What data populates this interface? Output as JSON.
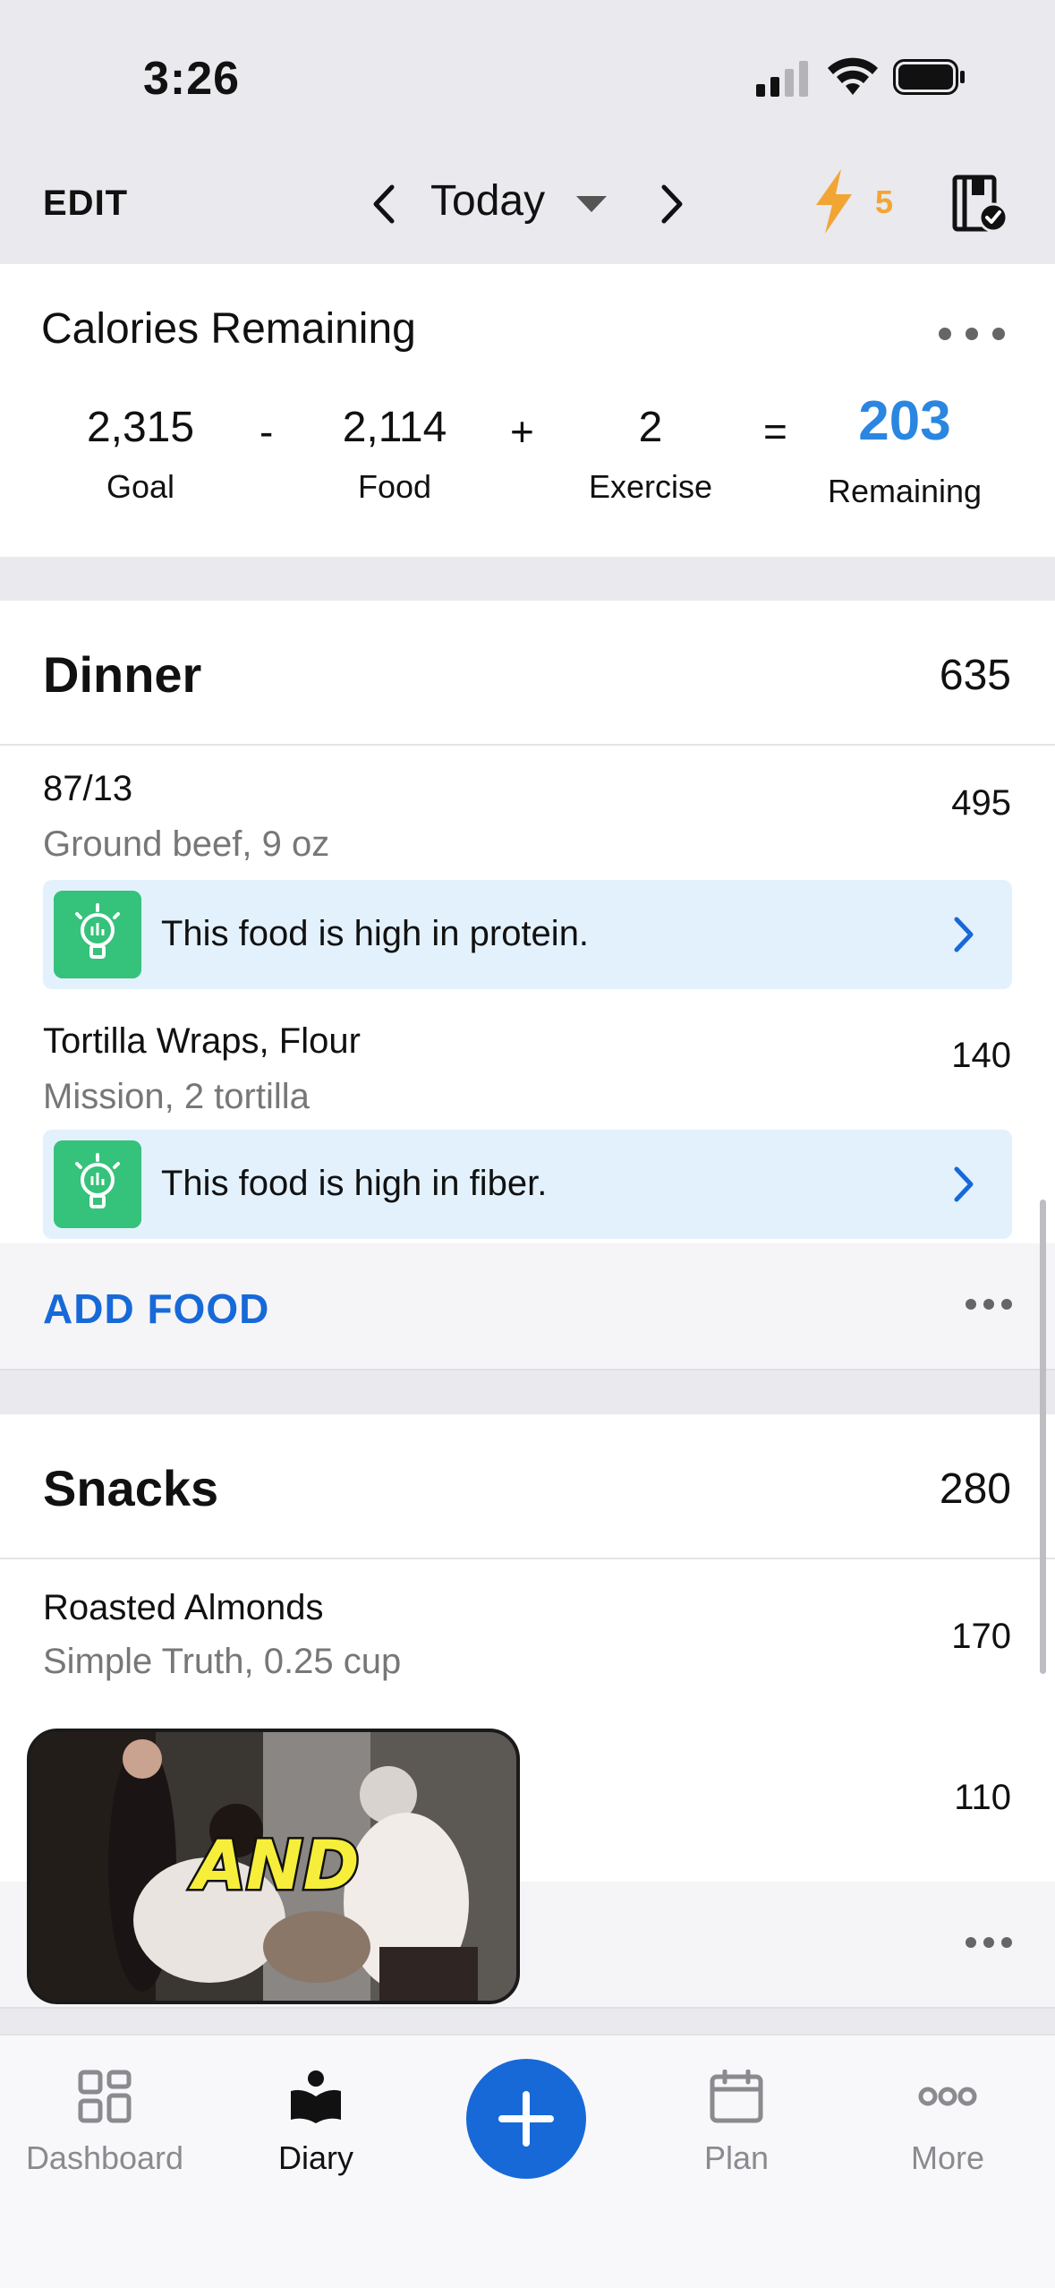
{
  "status_bar": {
    "time": "3:26"
  },
  "nav": {
    "edit": "EDIT",
    "date": "Today",
    "streak_count": "5"
  },
  "calories": {
    "title": "Calories Remaining",
    "goal": "2,315",
    "goal_label": "Goal",
    "minus": "-",
    "food": "2,114",
    "food_label": "Food",
    "plus": "+",
    "exercise": "2",
    "exercise_label": "Exercise",
    "equals": "=",
    "remaining": "203",
    "remaining_label": "Remaining"
  },
  "dinner": {
    "name": "Dinner",
    "total": "635",
    "items": [
      {
        "name": "87/13",
        "desc": "Ground beef, 9 oz",
        "cal": "495",
        "tip": "This food is high in protein."
      },
      {
        "name": "Tortilla Wraps, Flour",
        "desc": "Mission, 2 tortilla",
        "cal": "140",
        "tip": "This food is high in fiber."
      }
    ],
    "add_label": "ADD FOOD"
  },
  "snacks": {
    "name": "Snacks",
    "total": "280",
    "items": [
      {
        "name": "Roasted Almonds",
        "desc": "Simple Truth, 0.25 cup",
        "cal": "170"
      },
      {
        "name": "",
        "desc": "",
        "cal": "110"
      }
    ]
  },
  "video_overlay": {
    "caption": "AND"
  },
  "tabs": [
    {
      "label": "Dashboard",
      "icon": "dashboard-icon"
    },
    {
      "label": "Diary",
      "icon": "diary-icon"
    },
    {
      "label": "",
      "icon": "plus-icon"
    },
    {
      "label": "Plan",
      "icon": "calendar-icon"
    },
    {
      "label": "More",
      "icon": "more-icon"
    }
  ],
  "colors": {
    "accent": "#1769d8",
    "remaining": "#2a86e0",
    "streak": "#f3a534",
    "tip_bg": "#e3f1fd",
    "tip_icon": "#35c27a"
  }
}
